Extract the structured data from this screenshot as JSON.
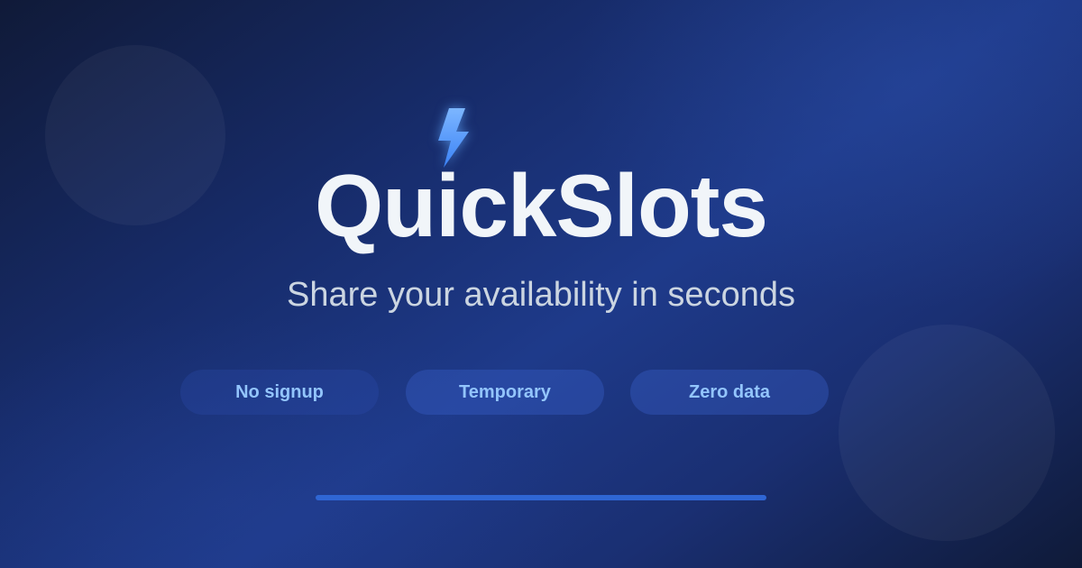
{
  "brand": {
    "name": "QuickSlots",
    "icon": "lightning-bolt-icon",
    "tagline": "Share your availability in seconds"
  },
  "features": [
    {
      "label": "No signup"
    },
    {
      "label": "Temporary"
    },
    {
      "label": "Zero data"
    }
  ],
  "colors": {
    "background_dark": "#101a38",
    "background_mid": "#1e3a8a",
    "title_text": "#f1f5f9",
    "tagline_text": "#cbd5e1",
    "pill_text": "#93c5fd",
    "bolt": "#60a5fa",
    "accent_bar": "#2f66d4"
  }
}
